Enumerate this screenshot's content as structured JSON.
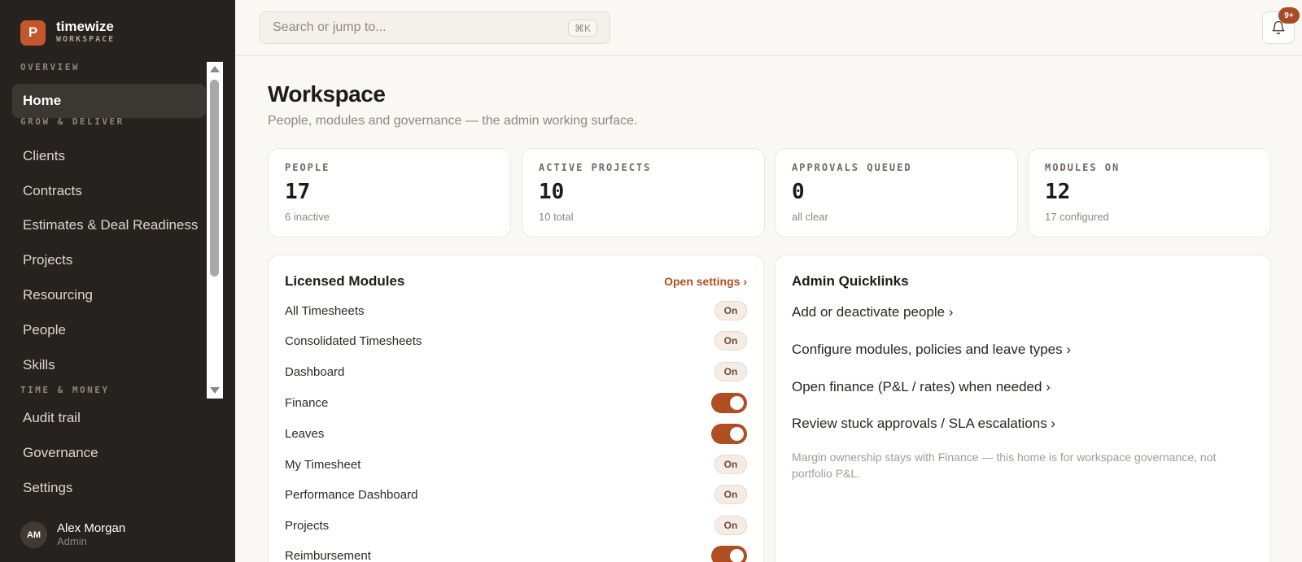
{
  "brand": {
    "logo_letter": "P",
    "name": "timewize",
    "subtitle": "WORKSPACE"
  },
  "sidebar": {
    "sections": [
      {
        "label": "OVERVIEW"
      },
      {
        "label": "GROW & DELIVER"
      },
      {
        "label": "TIME & MONEY"
      }
    ],
    "items": [
      {
        "label": "Home",
        "active": true
      },
      {
        "label": "Clients"
      },
      {
        "label": "Contracts"
      },
      {
        "label": "Estimates & Deal Readiness"
      },
      {
        "label": "Projects"
      },
      {
        "label": "Resourcing"
      },
      {
        "label": "People"
      },
      {
        "label": "Skills"
      },
      {
        "label": "Audit trail"
      },
      {
        "label": "Governance"
      },
      {
        "label": "Settings"
      }
    ],
    "user": {
      "initials": "AM",
      "name": "Alex Morgan",
      "role": "Admin"
    }
  },
  "topbar": {
    "search_placeholder": "Search or jump to...",
    "search_shortcut": "⌘K",
    "notifications_badge": "9+"
  },
  "page": {
    "title": "Workspace",
    "subtitle": "People, modules and governance — the admin working surface."
  },
  "stats": [
    {
      "label": "PEOPLE",
      "value": "17",
      "note": "6 inactive"
    },
    {
      "label": "ACTIVE PROJECTS",
      "value": "10",
      "note": "10 total"
    },
    {
      "label": "APPROVALS QUEUED",
      "value": "0",
      "note": "all clear"
    },
    {
      "label": "MODULES ON",
      "value": "12",
      "note": "17 configured"
    }
  ],
  "modules": {
    "title": "Licensed Modules",
    "link": "Open settings ›",
    "items": [
      {
        "name": "All Timesheets",
        "state": "On",
        "kind": "pill"
      },
      {
        "name": "Consolidated Timesheets",
        "state": "On",
        "kind": "pill"
      },
      {
        "name": "Dashboard",
        "state": "On",
        "kind": "pill"
      },
      {
        "name": "Finance",
        "state": "on",
        "kind": "toggle"
      },
      {
        "name": "Leaves",
        "state": "on",
        "kind": "toggle"
      },
      {
        "name": "My Timesheet",
        "state": "On",
        "kind": "pill"
      },
      {
        "name": "Performance Dashboard",
        "state": "On",
        "kind": "pill"
      },
      {
        "name": "Projects",
        "state": "On",
        "kind": "pill"
      },
      {
        "name": "Reimbursement",
        "state": "on",
        "kind": "toggle"
      }
    ]
  },
  "quicklinks": {
    "title": "Admin Quicklinks",
    "items": [
      "Add or deactivate people ›",
      "Configure modules, policies and leave types ›",
      "Open finance (P&L / rates) when needed ›",
      "Review stuck approvals / SLA escalations ›"
    ],
    "note": "Margin ownership stays with Finance — this home is for workspace governance, not portfolio P&L."
  },
  "colors": {
    "accent": "#b04e22",
    "sidebar_bg": "#252220",
    "page_bg": "#faf8f4"
  }
}
